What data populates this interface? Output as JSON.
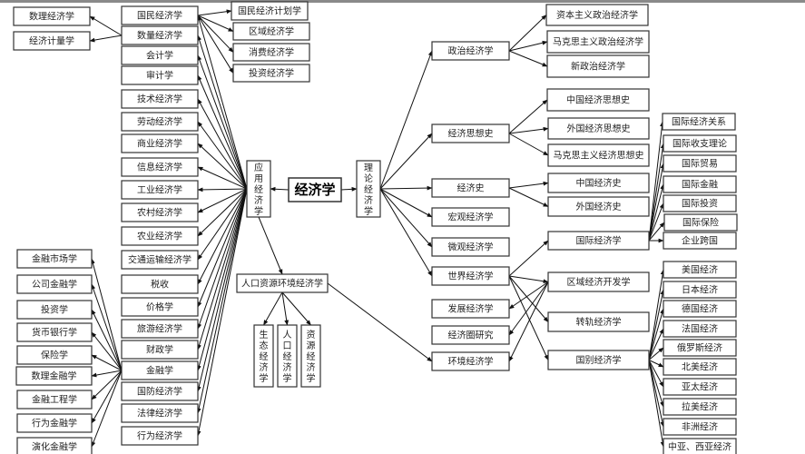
{
  "diagram": {
    "root": {
      "id": "econ",
      "label": "经济学"
    },
    "nodes": [
      {
        "id": "applied",
        "label": "应用经济学",
        "vertical": true
      },
      {
        "id": "theory",
        "label": "理论经济学",
        "vertical": true
      },
      {
        "id": "guomin",
        "label": "国民经济学"
      },
      {
        "id": "shuliang",
        "label": "数量经济学"
      },
      {
        "id": "kuaiji",
        "label": "会计学"
      },
      {
        "id": "shenji",
        "label": "审计学"
      },
      {
        "id": "jishu",
        "label": "技术经济学"
      },
      {
        "id": "laodong",
        "label": "劳动经济学"
      },
      {
        "id": "shangye",
        "label": "商业经济学"
      },
      {
        "id": "xinxi",
        "label": "信息经济学"
      },
      {
        "id": "gongye",
        "label": "工业经济学"
      },
      {
        "id": "nongcun",
        "label": "农村经济学"
      },
      {
        "id": "nongye",
        "label": "农业经济学"
      },
      {
        "id": "jiaotong",
        "label": "交通运输经济学"
      },
      {
        "id": "shuishou",
        "label": "税收"
      },
      {
        "id": "jiage",
        "label": "价格学"
      },
      {
        "id": "lvyou",
        "label": "旅游经济学"
      },
      {
        "id": "caizheng",
        "label": "财政学"
      },
      {
        "id": "jinrong",
        "label": "金融学"
      },
      {
        "id": "guofang",
        "label": "国防经济学"
      },
      {
        "id": "falv",
        "label": "法律经济学"
      },
      {
        "id": "xingwei",
        "label": "行为经济学"
      },
      {
        "id": "shuli",
        "label": "数理经济学"
      },
      {
        "id": "jiliang",
        "label": "经济计量学"
      },
      {
        "id": "jihua",
        "label": "国民经济计划学"
      },
      {
        "id": "quyu1",
        "label": "区域经济学"
      },
      {
        "id": "xiaofei",
        "label": "消费经济学"
      },
      {
        "id": "touzi1",
        "label": "投资经济学"
      },
      {
        "id": "f1",
        "label": "金融市场学"
      },
      {
        "id": "f2",
        "label": "公司金融学"
      },
      {
        "id": "f3",
        "label": "投资学"
      },
      {
        "id": "f4",
        "label": "货币银行学"
      },
      {
        "id": "f5",
        "label": "保险学"
      },
      {
        "id": "f6",
        "label": "数理金融学"
      },
      {
        "id": "f7",
        "label": "金融工程学"
      },
      {
        "id": "f8",
        "label": "行为金融学"
      },
      {
        "id": "f9",
        "label": "演化金融学"
      },
      {
        "id": "renkou",
        "label": "人口资源环境经济学"
      },
      {
        "id": "shengtai",
        "label": "生态经济学",
        "vertical": true
      },
      {
        "id": "renkoujj",
        "label": "人口经济学",
        "vertical": true
      },
      {
        "id": "ziyuan",
        "label": "资源经济学",
        "vertical": true
      },
      {
        "id": "zhengzhi",
        "label": "政治经济学"
      },
      {
        "id": "sixiang",
        "label": "经济思想史"
      },
      {
        "id": "jjshi",
        "label": "经济史"
      },
      {
        "id": "hongguan",
        "label": "宏观经济学"
      },
      {
        "id": "weiguan",
        "label": "微观经济学"
      },
      {
        "id": "shijie",
        "label": "世界经济学"
      },
      {
        "id": "fazhan",
        "label": "发展经济学"
      },
      {
        "id": "quan",
        "label": "经济圈研究"
      },
      {
        "id": "huanjing",
        "label": "环境经济学"
      },
      {
        "id": "ziben",
        "label": "资本主义政治经济学"
      },
      {
        "id": "makezz",
        "label": "马克思主义政治经济学"
      },
      {
        "id": "xinzz",
        "label": "新政治经济学"
      },
      {
        "id": "zgsx",
        "label": "中国经济思想史"
      },
      {
        "id": "wgsx",
        "label": "外国经济思想史"
      },
      {
        "id": "mksx",
        "label": "马克思主义经济思想史"
      },
      {
        "id": "zgjjs",
        "label": "中国经济史"
      },
      {
        "id": "wgjjs",
        "label": "外国经济史"
      },
      {
        "id": "guoji",
        "label": "国际经济学"
      },
      {
        "id": "quyukf",
        "label": "区域经济开发学"
      },
      {
        "id": "zhuangui",
        "label": "转轨经济学"
      },
      {
        "id": "guobie",
        "label": "国别经济学"
      },
      {
        "id": "g1",
        "label": "国际经济关系"
      },
      {
        "id": "g2",
        "label": "国际收支理论"
      },
      {
        "id": "g3",
        "label": "国际贸易"
      },
      {
        "id": "g4",
        "label": "国际金融"
      },
      {
        "id": "g5",
        "label": "国际投资"
      },
      {
        "id": "g6",
        "label": "国际保险"
      },
      {
        "id": "g7",
        "label": "企业跨国"
      },
      {
        "id": "c1",
        "label": "美国经济"
      },
      {
        "id": "c2",
        "label": "日本经济"
      },
      {
        "id": "c3",
        "label": "德国经济"
      },
      {
        "id": "c4",
        "label": "法国经济"
      },
      {
        "id": "c5",
        "label": "俄罗斯经济"
      },
      {
        "id": "c6",
        "label": "北美经济"
      },
      {
        "id": "c7",
        "label": "亚太经济"
      },
      {
        "id": "c8",
        "label": "拉美经济"
      },
      {
        "id": "c9",
        "label": "非洲经济"
      },
      {
        "id": "c10",
        "label": "中亚、西亚经济"
      }
    ],
    "edges": [
      [
        "econ",
        "applied"
      ],
      [
        "econ",
        "theory"
      ],
      [
        "applied",
        "guomin"
      ],
      [
        "applied",
        "shuliang"
      ],
      [
        "applied",
        "kuaiji"
      ],
      [
        "applied",
        "shenji"
      ],
      [
        "applied",
        "jishu"
      ],
      [
        "applied",
        "laodong"
      ],
      [
        "applied",
        "shangye"
      ],
      [
        "applied",
        "xinxi"
      ],
      [
        "applied",
        "gongye"
      ],
      [
        "applied",
        "nongcun"
      ],
      [
        "applied",
        "nongye"
      ],
      [
        "applied",
        "jiaotong"
      ],
      [
        "applied",
        "shuishou"
      ],
      [
        "applied",
        "jiage"
      ],
      [
        "applied",
        "lvyou"
      ],
      [
        "applied",
        "caizheng"
      ],
      [
        "applied",
        "jinrong"
      ],
      [
        "applied",
        "guofang"
      ],
      [
        "applied",
        "falv"
      ],
      [
        "applied",
        "xingwei"
      ],
      [
        "applied",
        "renkou"
      ],
      [
        "shuliang",
        "shuli"
      ],
      [
        "shuliang",
        "jiliang"
      ],
      [
        "guomin",
        "jihua"
      ],
      [
        "guomin",
        "quyu1"
      ],
      [
        "guomin",
        "xiaofei"
      ],
      [
        "guomin",
        "touzi1"
      ],
      [
        "jinrong",
        "f1"
      ],
      [
        "jinrong",
        "f2"
      ],
      [
        "jinrong",
        "f3"
      ],
      [
        "jinrong",
        "f4"
      ],
      [
        "jinrong",
        "f5"
      ],
      [
        "jinrong",
        "f6"
      ],
      [
        "jinrong",
        "f7"
      ],
      [
        "jinrong",
        "f8"
      ],
      [
        "jinrong",
        "f9"
      ],
      [
        "renkou",
        "shengtai"
      ],
      [
        "renkou",
        "renkoujj"
      ],
      [
        "renkou",
        "ziyuan"
      ],
      [
        "renkou",
        "huanjing"
      ],
      [
        "theory",
        "zhengzhi"
      ],
      [
        "theory",
        "sixiang"
      ],
      [
        "theory",
        "jjshi"
      ],
      [
        "theory",
        "hongguan"
      ],
      [
        "theory",
        "weiguan"
      ],
      [
        "theory",
        "shijie"
      ],
      [
        "zhengzhi",
        "ziben"
      ],
      [
        "zhengzhi",
        "makezz"
      ],
      [
        "zhengzhi",
        "xinzz"
      ],
      [
        "sixiang",
        "zgsx"
      ],
      [
        "sixiang",
        "wgsx"
      ],
      [
        "sixiang",
        "mksx"
      ],
      [
        "jjshi",
        "zgjjs"
      ],
      [
        "jjshi",
        "wgjjs"
      ],
      [
        "shijie",
        "guoji"
      ],
      [
        "shijie",
        "quyukf"
      ],
      [
        "shijie",
        "zhuangui"
      ],
      [
        "shijie",
        "guobie"
      ],
      [
        "quyukf",
        "fazhan"
      ],
      [
        "quyukf",
        "quan"
      ],
      [
        "quyukf",
        "huanjing"
      ],
      [
        "guoji",
        "g1"
      ],
      [
        "guoji",
        "g2"
      ],
      [
        "guoji",
        "g3"
      ],
      [
        "guoji",
        "g4"
      ],
      [
        "guoji",
        "g5"
      ],
      [
        "guoji",
        "g6"
      ],
      [
        "guoji",
        "g7"
      ],
      [
        "guobie",
        "c1"
      ],
      [
        "guobie",
        "c2"
      ],
      [
        "guobie",
        "c3"
      ],
      [
        "guobie",
        "c4"
      ],
      [
        "guobie",
        "c5"
      ],
      [
        "guobie",
        "c6"
      ],
      [
        "guobie",
        "c7"
      ],
      [
        "guobie",
        "c8"
      ],
      [
        "guobie",
        "c9"
      ],
      [
        "guobie",
        "c10"
      ]
    ]
  }
}
